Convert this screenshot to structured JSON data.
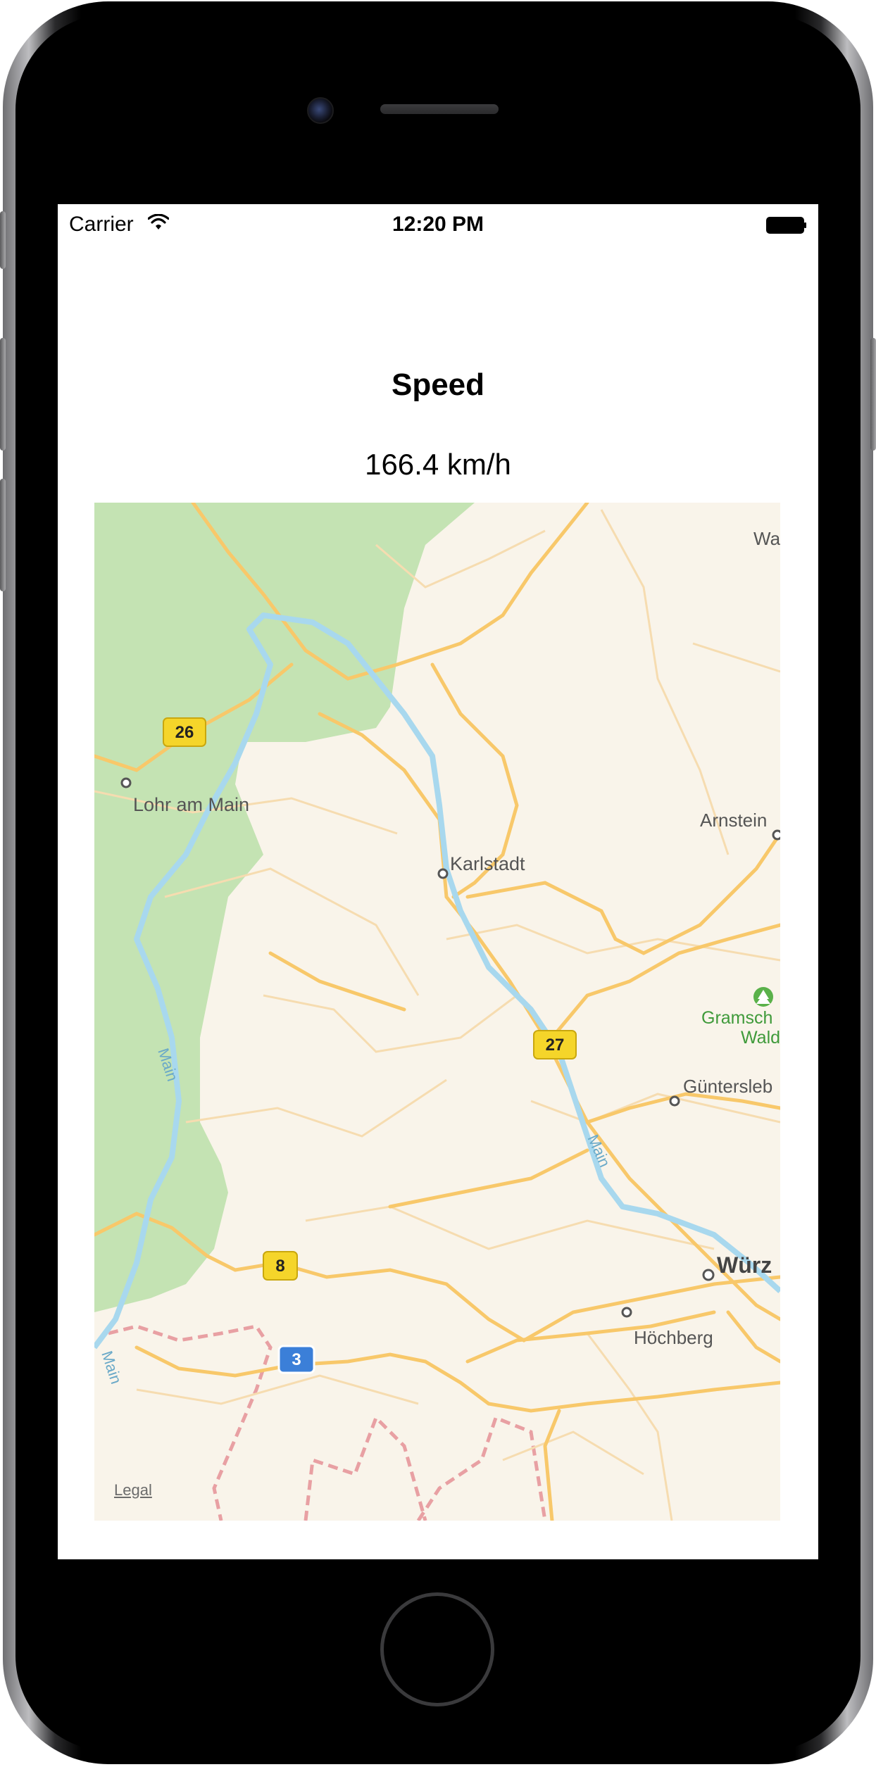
{
  "status_bar": {
    "carrier": "Carrier",
    "time": "12:20 PM"
  },
  "header": {
    "title": "Speed",
    "speed_value": "166.4 km/h"
  },
  "map": {
    "legal": "Legal",
    "places": {
      "lohr": "Lohr am Main",
      "karlstadt": "Karlstadt",
      "arnstein": "Arnstein",
      "wa": "Wa",
      "gramsch": "Gramsch",
      "wald": "Wald",
      "guentersleb": "Güntersleb",
      "wuerz": "Würz",
      "hoechberg": "Höchberg"
    },
    "river_labels": {
      "main_1": "Main",
      "main_2": "Main",
      "main_3": "Main"
    },
    "road_shields": {
      "r26": "26",
      "r27": "27",
      "r8": "8",
      "a3": "3"
    },
    "colors": {
      "land": "#f9f4ea",
      "forest": "#c4e3b3",
      "road": "#f8c86a",
      "minor_road": "#f6dcb0",
      "river": "#a8d8ee",
      "border": "#e8a0a3",
      "shield_yellow": "#f5d52a",
      "shield_blue": "#3b7fd8"
    }
  }
}
